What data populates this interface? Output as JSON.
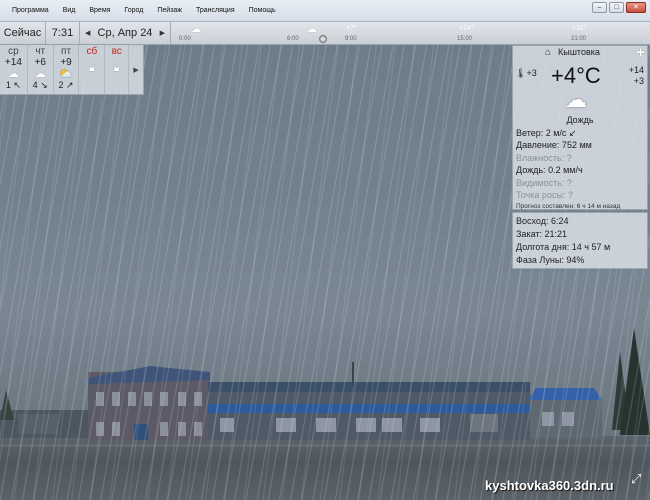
{
  "menu": [
    "Программа",
    "Вид",
    "Время",
    "Город",
    "Пейзаж",
    "Трансляция",
    "Помощь"
  ],
  "timebar": {
    "now_label": "Сейчас",
    "time": "7:31",
    "date": "Ср, Апр 24",
    "prev_icon": "triangle-left",
    "next_icon": "triangle-right",
    "timeline_labels": [
      "0:00",
      "6:00",
      "9:00",
      "15:00",
      "21:00"
    ],
    "timeline_temps": [
      "+7°",
      "+14°",
      "+11°"
    ]
  },
  "forecast": {
    "days": [
      {
        "name": "ср",
        "temp": "+14",
        "icon": "rain-cloud",
        "wind_speed": "1",
        "wind_dir": "↖",
        "weekend": false
      },
      {
        "name": "чт",
        "temp": "+6",
        "icon": "rain-cloud",
        "wind_speed": "4",
        "wind_dir": "↘",
        "weekend": false
      },
      {
        "name": "пт",
        "temp": "+9",
        "icon": "sun-cloud",
        "wind_speed": "2",
        "wind_dir": "↗",
        "weekend": false
      },
      {
        "name": "сб",
        "temp": "",
        "icon": "lock",
        "wind_speed": "",
        "wind_dir": "",
        "weekend": true
      },
      {
        "name": "вс",
        "temp": "",
        "icon": "lock",
        "wind_speed": "",
        "wind_dir": "",
        "weekend": true
      }
    ],
    "expand_icon": "triangle-right"
  },
  "current": {
    "city": "Кыштовка",
    "temperature": "+4°C",
    "left_small": "+3",
    "right_small_top": "+14",
    "right_small_bottom": "+3",
    "condition": "Дождь",
    "wind": "Ветер:  2 м/с ↙",
    "pressure": "Давление:  752 мм",
    "humidity": "Влажность:  ?",
    "rain": "Дождь:  0.2 мм/ч",
    "visibility": "Видимость:  ?",
    "dewpoint": "Точка росы:  ?",
    "forecast_made": "Прогноз составлен:  6 ч 14 м назад"
  },
  "astro": {
    "sunrise": "Восход:  6:24",
    "sunset": "Закат:  21:21",
    "day_length": "Долгота дня:   14 ч 57 м",
    "moon_phase": "Фаза Луны:  94%"
  },
  "watermark": "kyshtovka360.3dn.ru"
}
